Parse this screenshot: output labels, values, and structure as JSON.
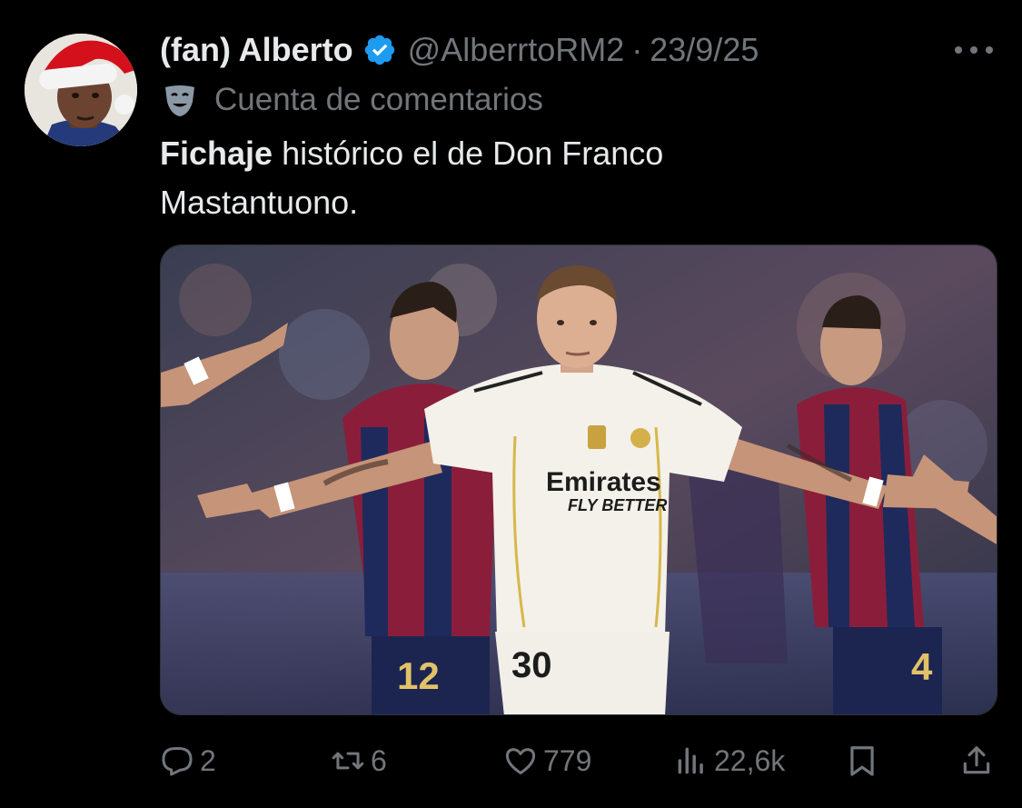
{
  "author": {
    "display_name": "(fan) Alberto",
    "handle": "@AlberrtoRM2",
    "date": "23/9/25",
    "verified": true
  },
  "label": {
    "text": "Cuenta de comentarios",
    "icon": "theater-mask-icon"
  },
  "body": {
    "bold_word": "Fichaje",
    "rest_line1": " histórico el de Don Franco",
    "line2": "Mastantuono."
  },
  "media": {
    "jersey_sponsor": "Emirates",
    "jersey_tagline": "FLY BETTER",
    "player_number": "30",
    "opponent_number_left": "12",
    "opponent_number_right": "4"
  },
  "actions": {
    "replies": "2",
    "reposts": "6",
    "likes": "779",
    "views": "22,6k"
  },
  "colors": {
    "background": "#000000",
    "text_primary": "#e7e9ea",
    "text_secondary": "#71767b",
    "verified_blue": "#1d9bf0"
  }
}
